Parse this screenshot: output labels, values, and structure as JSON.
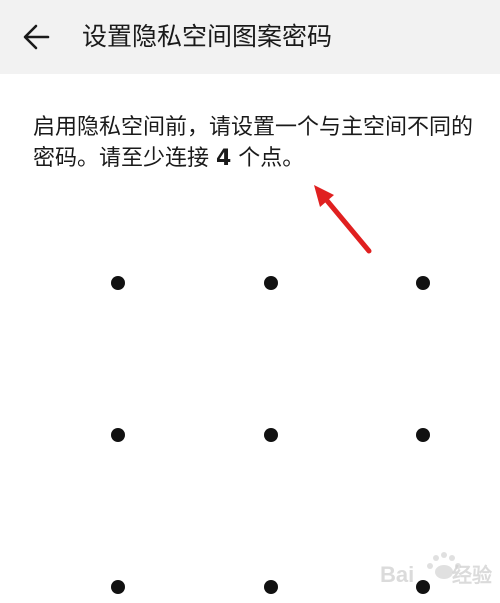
{
  "header": {
    "title": "设置隐私空间图案密码",
    "back_icon": "arrow-left-icon"
  },
  "instruction": {
    "part1": "启用隐私空间前，请设置一个与主空间不同的密码。请至少连接 ",
    "count": "4",
    "part2": " 个点。"
  },
  "pattern": {
    "rows": 3,
    "cols": 3,
    "dot_color": "#111111"
  },
  "annotation": {
    "arrow_color": "#e02020"
  },
  "watermark": {
    "text": "Baidu"
  }
}
